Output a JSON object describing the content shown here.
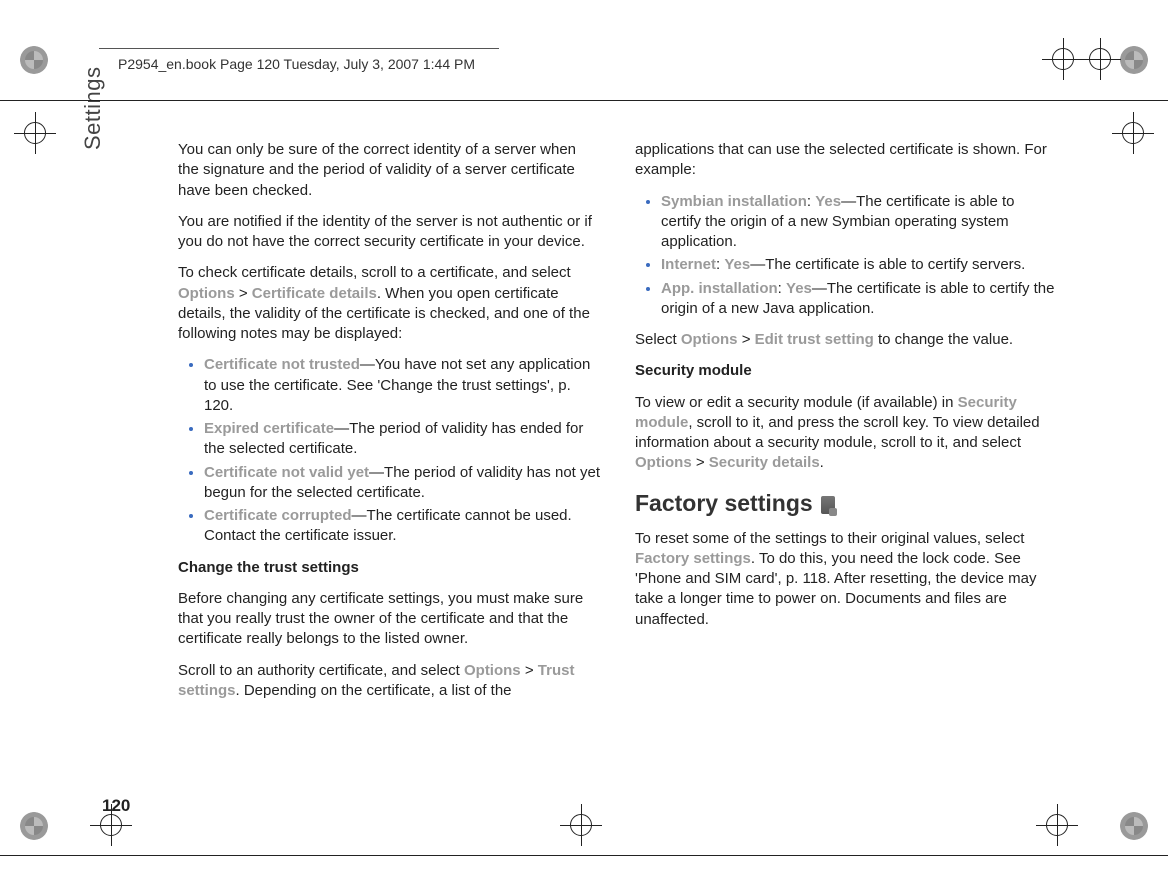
{
  "header": "P2954_en.book  Page 120  Tuesday, July 3, 2007  1:44 PM",
  "side_label": "Settings",
  "page_number": "120",
  "col1": {
    "p1": "You can only be sure of the correct identity of a server when the signature and the period of validity of a server certificate have been checked.",
    "p2": "You are notified if the identity of the server is not authentic or if you do not have the correct security certificate in your device.",
    "p3_a": "To check certificate details, scroll to a certificate, and select ",
    "p3_opt": "Options",
    "p3_gt": " > ",
    "p3_cd": "Certificate details",
    "p3_b": ". When you open certificate details, the validity of the certificate is checked, and one of the following notes may be displayed:",
    "b1_t": "Certificate not trusted",
    "b1_r": "—You have not set any application to use the certificate. See 'Change the trust settings', p. 120.",
    "b2_t": "Expired certificate",
    "b2_r": "—The period of validity has ended for the selected certificate.",
    "b3_t": "Certificate not valid yet",
    "b3_r": "—The period of validity has not yet begun for the selected certificate.",
    "b4_t": "Certificate corrupted",
    "b4_r": "—The certificate cannot be used. Contact the certificate issuer.",
    "h_cts": "Change the trust settings",
    "p4": "Before changing any certificate settings, you must make sure that you really trust the owner of the certificate and that the certificate really belongs to the listed owner.",
    "p5_a": "Scroll to an authority certificate, and select ",
    "p5_opt": "Options",
    "p5_gt": " > ",
    "p5_ts": "Trust settings",
    "p5_b": ". Depending on the certificate, a list of the"
  },
  "col2": {
    "p1": "applications that can use the selected certificate is shown. For example:",
    "b1_t": "Symbian installation",
    "b1_sep": ": ",
    "b1_y": "Yes",
    "b1_r": "—The certificate is able to certify the origin of a new Symbian operating system application.",
    "b2_t": "Internet",
    "b2_sep": ": ",
    "b2_y": "Yes",
    "b2_r": "—The certificate is able to certify servers.",
    "b3_t": "App. installation",
    "b3_sep": ": ",
    "b3_y": "Yes",
    "b3_r": "—The certificate is able to certify the origin of a new Java application.",
    "p2_a": "Select ",
    "p2_opt": "Options",
    "p2_gt": " > ",
    "p2_ets": "Edit trust setting",
    "p2_b": " to change the value.",
    "h_sm": "Security module",
    "p3_a": "To view or edit a security module (if available) in ",
    "p3_sm": "Security module",
    "p3_b": ", scroll to it, and press the scroll key. To view detailed information about a security module, scroll to it, and select ",
    "p3_opt": "Options",
    "p3_gt": " > ",
    "p3_sd": "Security details",
    "p3_c": ".",
    "h_fs": "Factory settings",
    "p4_a": "To reset some of the settings to their original values, select ",
    "p4_fs": "Factory settings",
    "p4_b": ". To do this, you need the lock code. See 'Phone and SIM card', p. 118. After resetting, the device may take a longer time to power on. Documents and files are unaffected."
  }
}
